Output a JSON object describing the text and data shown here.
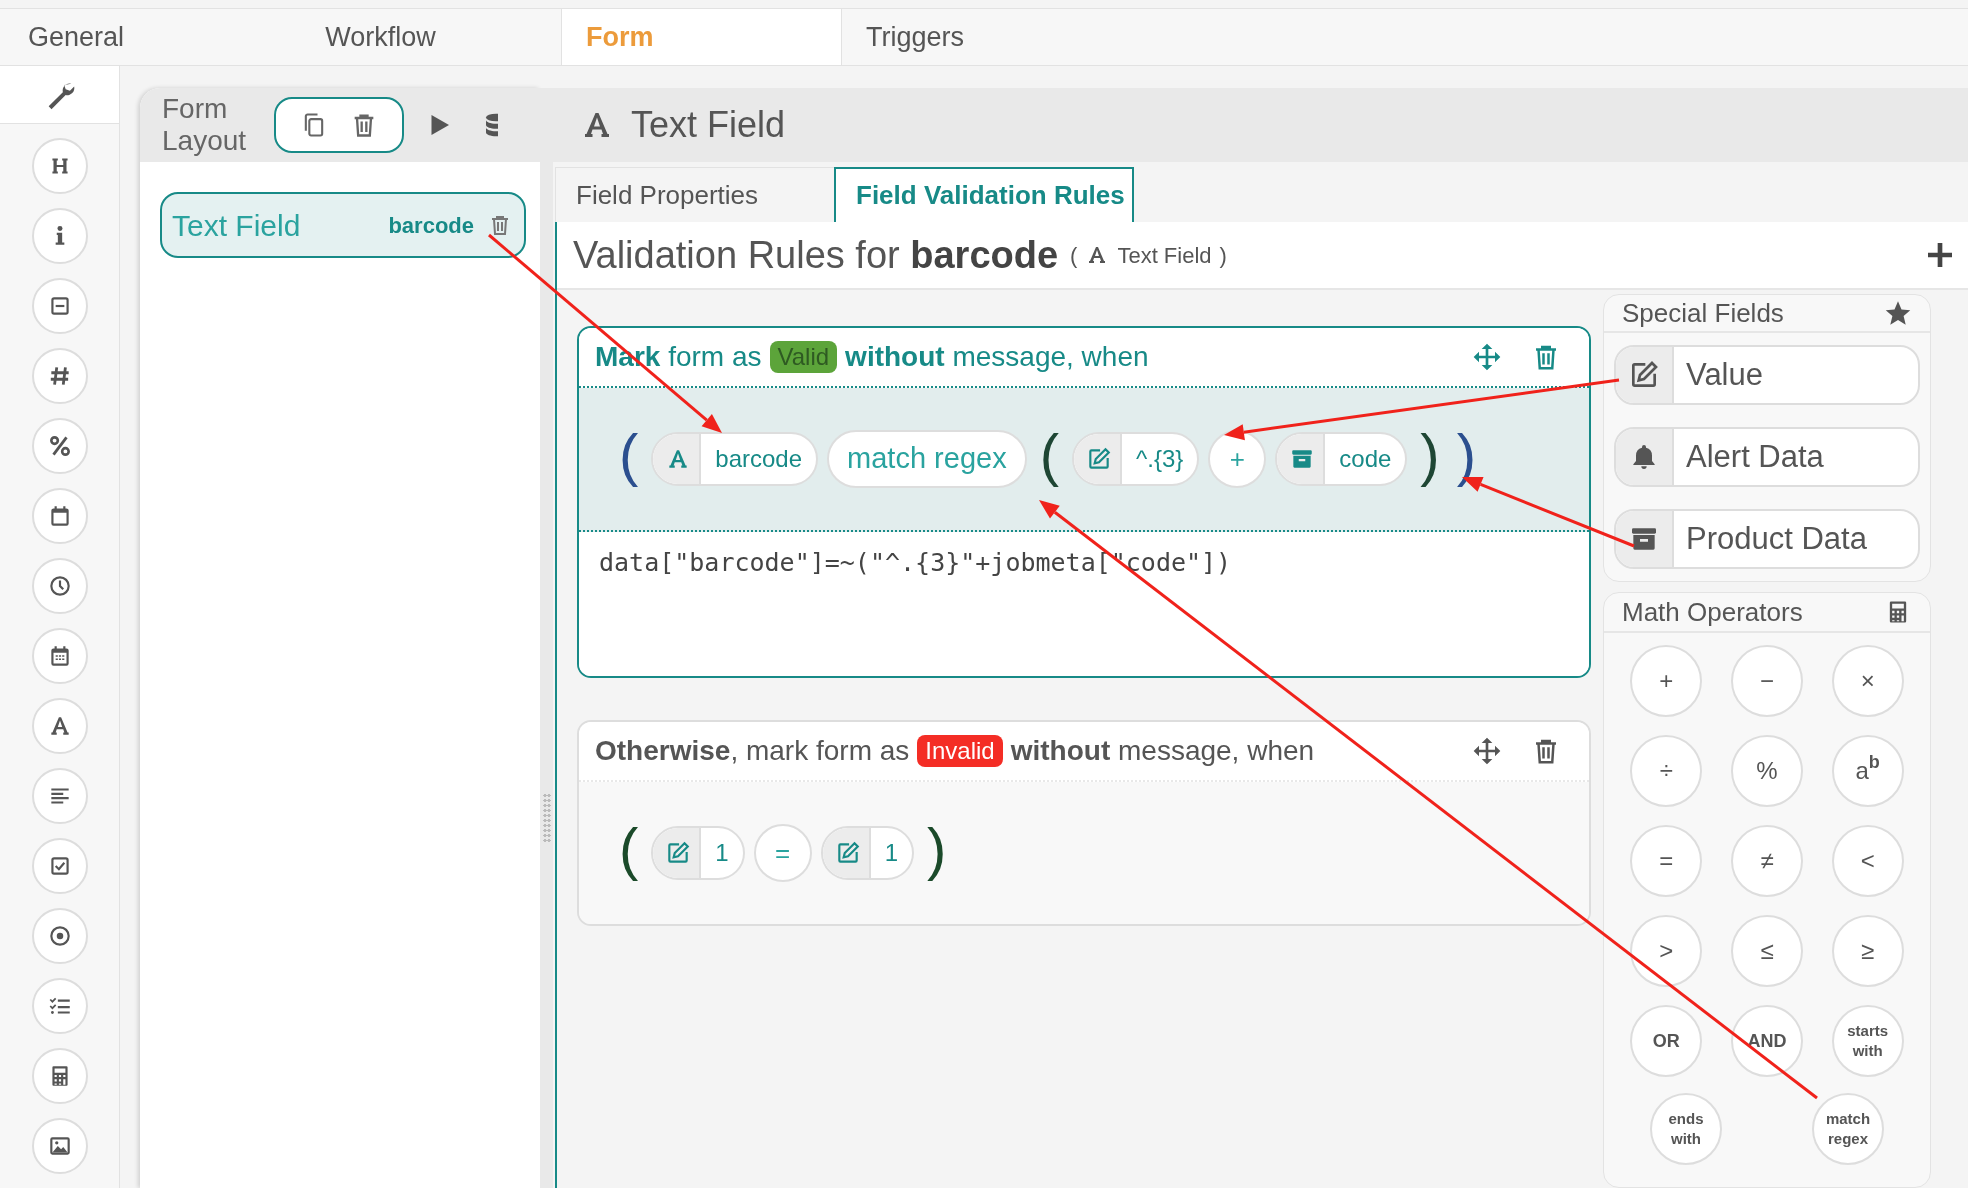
{
  "top_tabs": [
    {
      "label": "General",
      "selected": false
    },
    {
      "label": "Workflow",
      "selected": false
    },
    {
      "label": "Form",
      "selected": true
    },
    {
      "label": "Triggers",
      "selected": false
    }
  ],
  "form_layout": {
    "title": "Form Layout",
    "fields": [
      {
        "label": "Text Field",
        "name": "barcode",
        "selected": true
      }
    ]
  },
  "field_header": {
    "title": "Text Field"
  },
  "field_tabs": [
    {
      "label": "Field Properties",
      "selected": false
    },
    {
      "label": "Field Validation Rules",
      "selected": true
    }
  ],
  "validation": {
    "title": "Validation Rules for **barcode**",
    "type_open": "(",
    "field_type": "Text Field",
    "type_close": ")"
  },
  "rules": [
    {
      "kind": "if",
      "header": "**Mark** form as",
      "status": {
        "label": "Valid",
        "color": "#5ca43a"
      },
      "suffix": "**without** message, when",
      "code": "data[\"barcode\"]=~(\"^.{3}\"+jobmeta[\"code\"])",
      "expression": [
        {
          "kind": "paren",
          "text": "(",
          "color": "#2b4f8f"
        },
        {
          "kind": "field",
          "text": "barcode"
        },
        {
          "kind": "operator",
          "text": "match regex"
        },
        {
          "kind": "paren",
          "text": "(",
          "color": "#1e4634"
        },
        {
          "kind": "value",
          "text": "^.{3}"
        },
        {
          "kind": "operator",
          "text": "+"
        },
        {
          "kind": "product",
          "text": "code"
        },
        {
          "kind": "paren",
          "text": ")",
          "color": "#1e4634"
        },
        {
          "kind": "paren",
          "text": ")",
          "color": "#2b4f8f"
        }
      ]
    },
    {
      "kind": "otherwise",
      "header": "**Otherwise**, mark form as",
      "status": {
        "label": "Invalid",
        "color": "#f42d25"
      },
      "suffix": "**without** message, when",
      "expression": [
        {
          "kind": "paren",
          "text": "(",
          "color": "#1b4a2a"
        },
        {
          "kind": "value",
          "text": "1"
        },
        {
          "kind": "operator",
          "text": "="
        },
        {
          "kind": "value",
          "text": "1"
        },
        {
          "kind": "paren",
          "text": ")",
          "color": "#1b4a2a"
        }
      ]
    }
  ],
  "special_fields": {
    "title": "Special Fields",
    "items": [
      {
        "kind": "value",
        "label": "Value"
      },
      {
        "kind": "alert",
        "label": "Alert Data"
      },
      {
        "kind": "product",
        "label": "Product Data"
      }
    ]
  },
  "math_operators": {
    "title": "Math Operators",
    "items": [
      {
        "kind": "symbol",
        "text": "+"
      },
      {
        "kind": "symbol",
        "text": "−"
      },
      {
        "kind": "symbol",
        "text": "×"
      },
      {
        "kind": "symbol",
        "text": "÷"
      },
      {
        "kind": "symbol",
        "text": "%"
      },
      {
        "kind": "symbol",
        "text": "a$^{b}$"
      },
      {
        "kind": "symbol",
        "text": "="
      },
      {
        "kind": "symbol",
        "text": "≠"
      },
      {
        "kind": "symbol",
        "text": "<"
      },
      {
        "kind": "symbol",
        "text": ">"
      },
      {
        "kind": "symbol",
        "text": "≤"
      },
      {
        "kind": "symbol",
        "text": "≥"
      },
      {
        "kind": "word",
        "text": "OR"
      },
      {
        "kind": "word",
        "text": "AND"
      },
      {
        "kind": "word",
        "text": "starts with"
      },
      {
        "kind": "word",
        "text": "ends with"
      },
      {
        "kind": "word",
        "text": "match regex"
      }
    ]
  }
}
